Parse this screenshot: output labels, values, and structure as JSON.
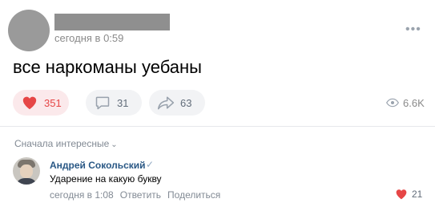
{
  "post": {
    "time": "сегодня в 0:59",
    "more_icon": "more-dots-icon",
    "text": "все наркоманы уебаны"
  },
  "actions": {
    "likes": "351",
    "comments": "31",
    "shares": "63",
    "views": "6.6K",
    "like_color": "#e64646"
  },
  "comments_section": {
    "sort_label": "Сначала интересные",
    "items": [
      {
        "author": "Андрей Сокольский",
        "text": "Ударение на какую букву",
        "time": "сегодня в 1:08",
        "reply_label": "Ответить",
        "share_label": "Поделиться",
        "likes": "21"
      }
    ]
  }
}
